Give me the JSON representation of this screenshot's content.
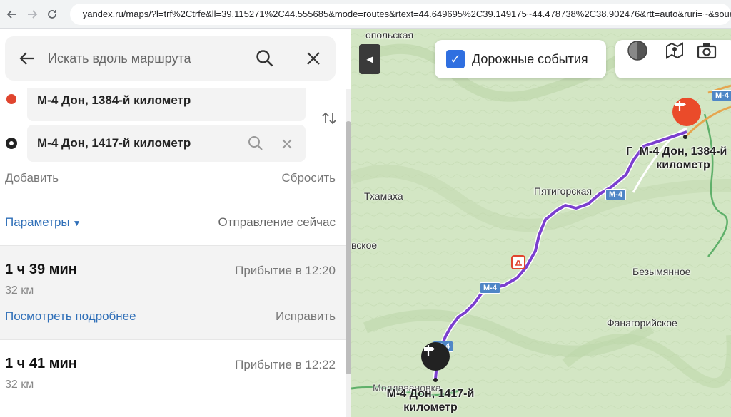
{
  "browser": {
    "url": "yandex.ru/maps/?l=trf%2Ctrfe&ll=39.115271%2C44.555685&mode=routes&rtext=44.649695%2C39.149175~44.478738%2C38.902476&rtt=auto&ruri=~&source=ser"
  },
  "panel": {
    "search_placeholder": "Искать вдоль маршрута",
    "point_a": "М-4 Дон, 1384-й километр",
    "point_b": "М-4 Дон, 1417-й километр",
    "add_label": "Добавить",
    "reset_label": "Сбросить",
    "params_label": "Параметры",
    "depart_label": "Отправление сейчас",
    "routes": [
      {
        "time": "1 ч 39 мин",
        "arrive": "Прибытие в 12:20",
        "distance": "32 км",
        "details": "Посмотреть подробнее",
        "fix": "Исправить"
      },
      {
        "time": "1 ч 41 мин",
        "arrive": "Прибытие в 12:22",
        "distance": "32 км"
      }
    ]
  },
  "map": {
    "traffic_label": "Дорожные события",
    "places": {
      "p1": "Пятигорская",
      "p2": "Тхамаха",
      "p3": "Безымянное",
      "p4": "Фанагорийское",
      "p5": "вское",
      "p6": "Г",
      "p7": "опольская",
      "p8": "Молдавановка"
    },
    "road": "М-4",
    "start_label": "М-4 Дон, 1384-й километр",
    "end_label": "М-4 Дон, 1417-й километр",
    "colors": {
      "route": "#7b3fcf",
      "start_pin": "#ea4b2a",
      "end_pin": "#222222",
      "link": "#2f6fb8"
    }
  }
}
